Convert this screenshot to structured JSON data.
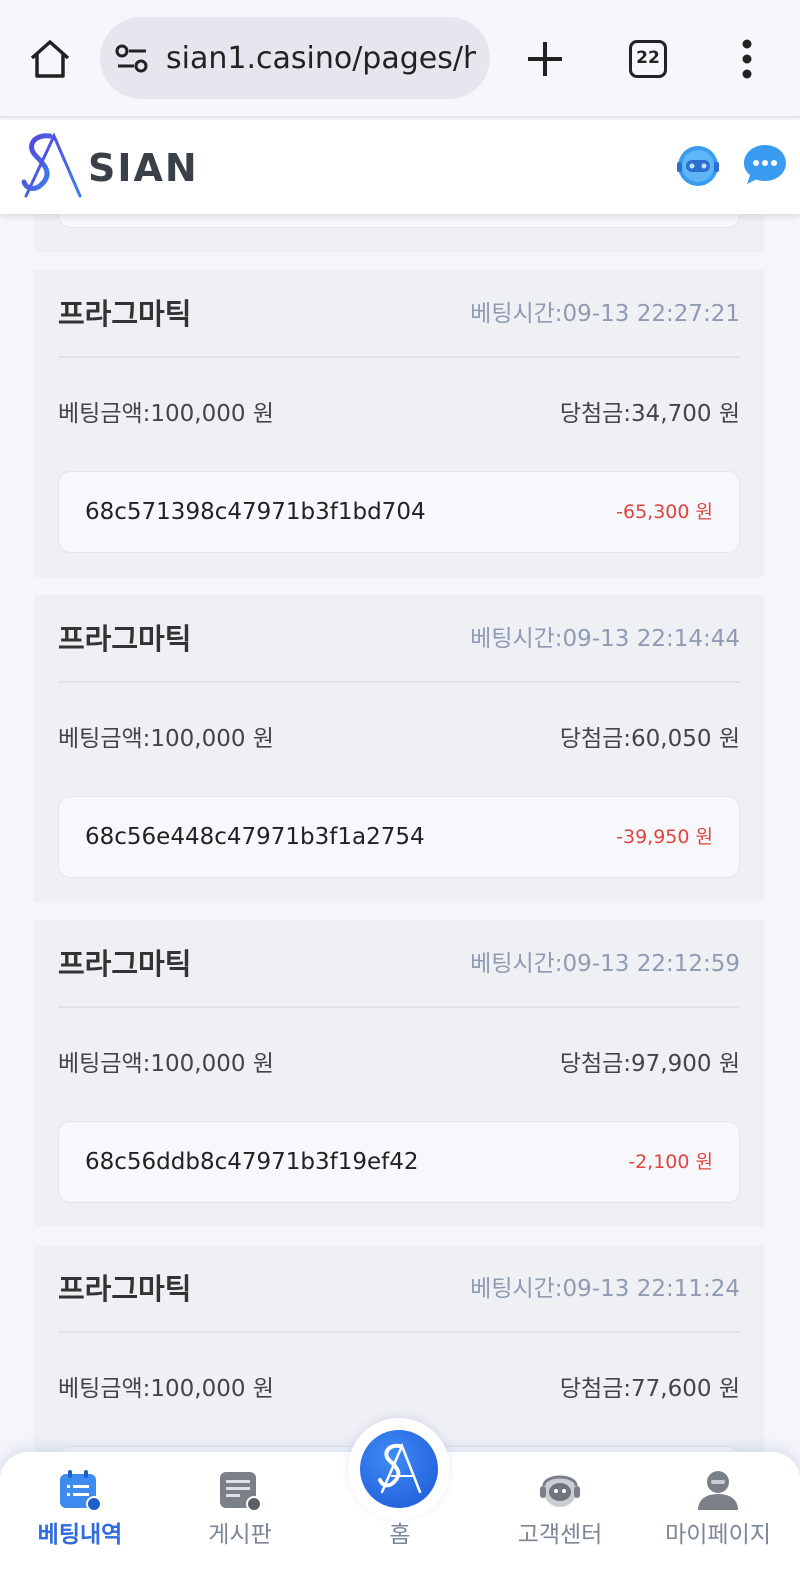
{
  "browser": {
    "url": "sian1.casino/pages/h",
    "tab_count": "22"
  },
  "site": {
    "logo_text": "SIAN"
  },
  "cards": [
    {
      "provider": "프라그마틱",
      "bet_time": "베팅시간:09-13 22:27:21",
      "bet_amount": "베팅금액:100,000 원",
      "win_amount": "당첨금:34,700 원",
      "transaction_id": "68c571398c47971b3f1bd704",
      "difference": "-65,300 원"
    },
    {
      "provider": "프라그마틱",
      "bet_time": "베팅시간:09-13 22:14:44",
      "bet_amount": "베팅금액:100,000 원",
      "win_amount": "당첨금:60,050 원",
      "transaction_id": "68c56e448c47971b3f1a2754",
      "difference": "-39,950 원"
    },
    {
      "provider": "프라그마틱",
      "bet_time": "베팅시간:09-13 22:12:59",
      "bet_amount": "베팅금액:100,000 원",
      "win_amount": "당첨금:97,900 원",
      "transaction_id": "68c56ddb8c47971b3f19ef42",
      "difference": "-2,100 원"
    },
    {
      "provider": "프라그마틱",
      "bet_time": "베팅시간:09-13 22:11:24",
      "bet_amount": "베팅금액:100,000 원",
      "win_amount": "당첨금:77,600 원",
      "transaction_id": "",
      "difference": ""
    }
  ],
  "bottom_nav": {
    "items": [
      {
        "label": "베팅내역",
        "icon": "betting-history-icon",
        "active": true
      },
      {
        "label": "게시판",
        "icon": "board-icon",
        "active": false
      },
      {
        "label": "홈",
        "icon": "home-logo-icon",
        "active": false
      },
      {
        "label": "고객센터",
        "icon": "customer-center-icon",
        "active": false
      },
      {
        "label": "마이페이지",
        "icon": "my-page-icon",
        "active": false
      }
    ]
  },
  "colors": {
    "accent": "#2f6be0",
    "loss": "#e0443e",
    "time_text": "#8f9bb3"
  }
}
